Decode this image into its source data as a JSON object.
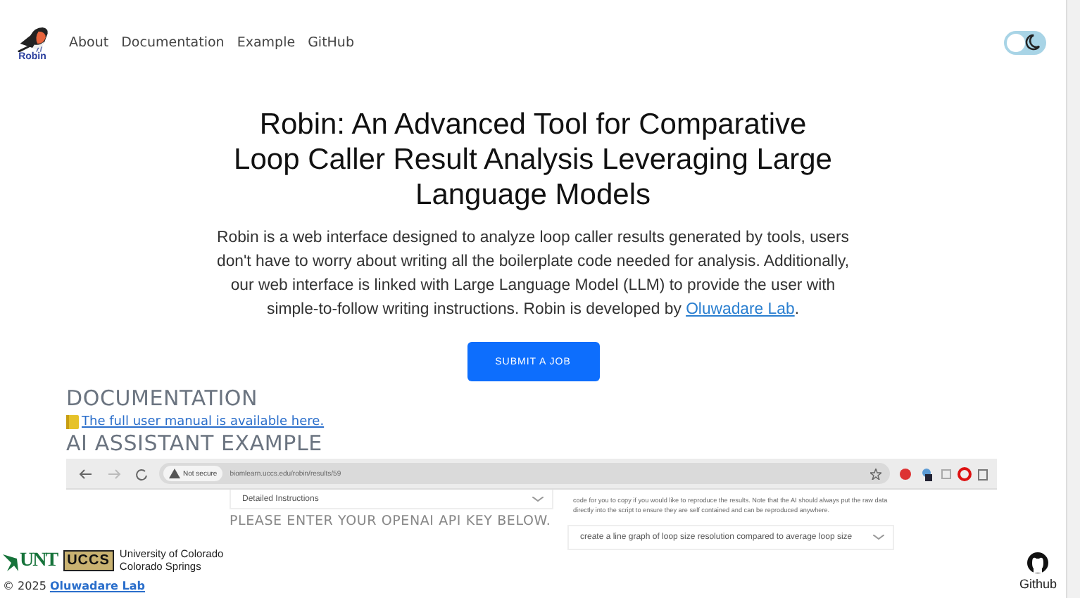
{
  "logo": {
    "text": "Robin"
  },
  "nav": [
    {
      "label": "About"
    },
    {
      "label": "Documentation"
    },
    {
      "label": "Example"
    },
    {
      "label": "GitHub"
    }
  ],
  "theme_toggle": {
    "on": false
  },
  "hero": {
    "title": "Robin: An Advanced Tool for Comparative Loop Caller Result Analysis Leveraging Large Language Models",
    "description": "Robin is a web interface designed to analyze loop caller results generated by tools, users don't have to worry about writing all the boilerplate code needed for analysis. Additionally, our web interface is linked with Large Language Model (LLM) to provide the user with simple-to-follow writing instructions. Robin is developed by ",
    "description_link": "Oluwadare Lab",
    "description_end": ".",
    "button": "SUBMIT A JOB"
  },
  "documentation": {
    "heading": "DOCUMENTATION",
    "link": "The full user manual is available here."
  },
  "example": {
    "heading": "AI ASSISTANT EXAMPLE",
    "screenshot": {
      "security": "Not secure",
      "url": "biomlearn.uccs.edu/robin/results/59",
      "dropdown": "Detailed Instructions",
      "prompt_heading": "PLEASE ENTER YOUR OPENAI API KEY BELOW.",
      "note": "code for you to copy if you would like to reproduce the results. Note that the AI should always put the raw data directly into the script to ensure they are self contained and can be reproduced anywhere.",
      "query": "create a line graph of loop size resolution compared to average loop size"
    }
  },
  "footer": {
    "logos": [
      {
        "text": "UNT",
        "kind": "unt"
      },
      {
        "text": "UCCS",
        "kind": "uccs",
        "caption": "University of Colorado Colorado Springs"
      }
    ],
    "copyright": "© 2025",
    "copyright_link": "Oluwadare Lab",
    "github": "Github"
  }
}
